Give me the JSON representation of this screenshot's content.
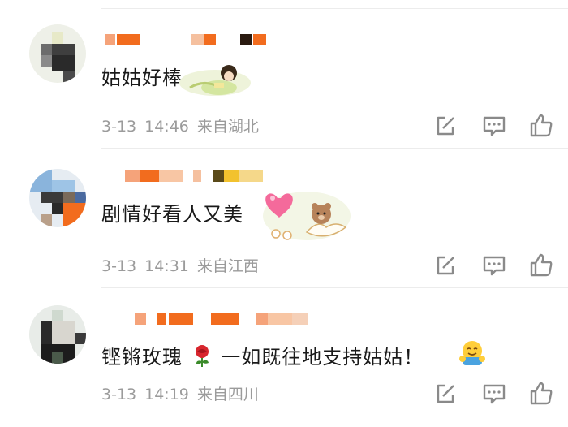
{
  "comments": [
    {
      "text": "姑姑好棒",
      "date": "3-13",
      "time": "14:46",
      "location": "来自湖北",
      "sticker": "girl-reading-sticker"
    },
    {
      "text": "剧情好看人又美",
      "date": "3-13",
      "time": "14:31",
      "location": "来自江西",
      "sticker": "heart-and-bear-sticker"
    },
    {
      "text": "铿锵玫瑰",
      "text_after": "一如既往地支持姑姑！",
      "date": "3-13",
      "time": "14:19",
      "location": "来自四川",
      "inline_emoji": "rose-emoji",
      "sticker": "hugging-emoji"
    }
  ],
  "action_icons": [
    "share-icon",
    "comment-icon",
    "like-icon"
  ],
  "colors": {
    "meta_text": "#9b9b9b",
    "icon": "#8a8a8a",
    "username_blur": "#f26c1e"
  }
}
